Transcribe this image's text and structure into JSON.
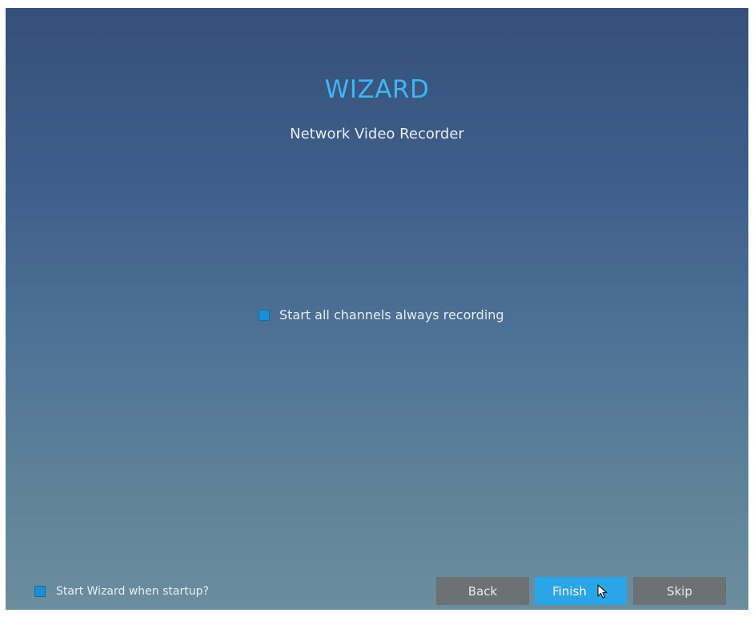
{
  "wizard": {
    "title": "WIZARD",
    "subtitle": "Network Video Recorder",
    "record_option": {
      "label": "Start all channels always recording",
      "checked": false
    },
    "startup_option": {
      "label": "Start Wizard when startup?",
      "checked": true
    },
    "buttons": {
      "back": "Back",
      "finish": "Finish",
      "skip": "Skip"
    }
  },
  "colors": {
    "accent": "#3fb6f3",
    "finish_button": "#2aa5e8",
    "secondary_button": "#6c7174",
    "checkbox": "#1a8fd6"
  },
  "icons": {
    "pointer": "mouse-pointer-icon"
  }
}
